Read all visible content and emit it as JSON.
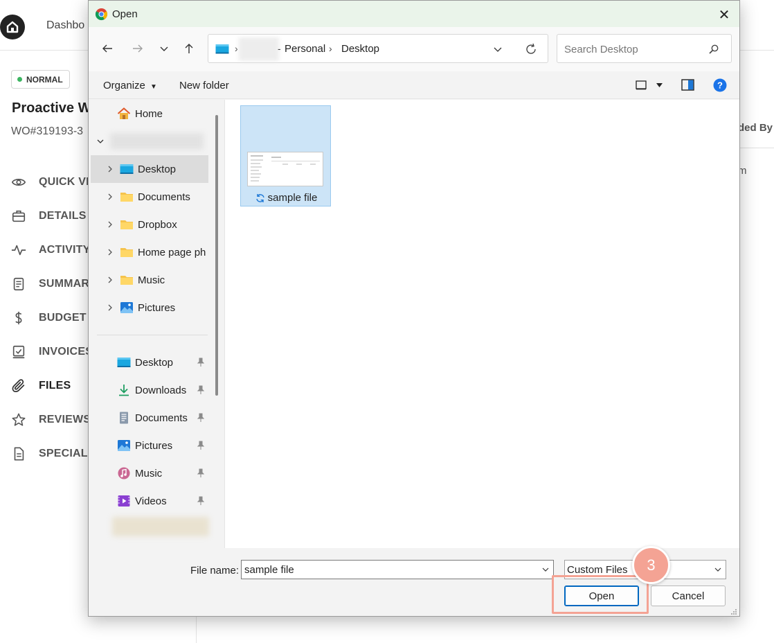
{
  "app": {
    "nav_text": "Dashbo",
    "status_badge": "NORMAL",
    "wo_title": "Proactive W",
    "wo_number": "WO#319193-3",
    "menu": [
      {
        "label": "QUICK VIE",
        "icon": "eye-icon"
      },
      {
        "label": "DETAILS",
        "icon": "briefcase-icon"
      },
      {
        "label": "ACTIVITY",
        "icon": "activity-icon"
      },
      {
        "label": "SUMMAR",
        "icon": "document-icon"
      },
      {
        "label": "BUDGET",
        "icon": "dollar-icon"
      },
      {
        "label": "INVOICES",
        "icon": "invoice-icon"
      },
      {
        "label": "FILES",
        "icon": "paperclip-icon"
      },
      {
        "label": "REVIEWS",
        "icon": "star-icon"
      },
      {
        "label": "SPECIAL N",
        "icon": "note-icon"
      }
    ],
    "right_header": "ded By",
    "right_value": "m"
  },
  "dialog": {
    "title": "Open",
    "close_glyph": "✕",
    "address": {
      "crumbs": [
        "Personal",
        "Desktop"
      ]
    },
    "search_placeholder": "Search Desktop",
    "toolbar": {
      "organize": "Organize",
      "new_folder": "New folder"
    },
    "nav_tree": [
      {
        "label": "Home",
        "icon": "home-icon",
        "expandable": false
      },
      {
        "label": "Desktop",
        "icon": "desktop-folder-icon",
        "expandable": true,
        "selected": true
      },
      {
        "label": "Documents",
        "icon": "folder-icon",
        "expandable": true
      },
      {
        "label": "Dropbox",
        "icon": "folder-icon",
        "expandable": true
      },
      {
        "label": "Home page ph",
        "icon": "folder-icon",
        "expandable": true
      },
      {
        "label": "Music",
        "icon": "folder-icon",
        "expandable": true
      },
      {
        "label": "Pictures",
        "icon": "pictures-icon",
        "expandable": true
      }
    ],
    "quick_access": [
      {
        "label": "Desktop",
        "icon": "desktop-folder-icon"
      },
      {
        "label": "Downloads",
        "icon": "download-icon"
      },
      {
        "label": "Documents",
        "icon": "documents-icon"
      },
      {
        "label": "Pictures",
        "icon": "pictures-icon"
      },
      {
        "label": "Music",
        "icon": "music-icon"
      },
      {
        "label": "Videos",
        "icon": "videos-icon"
      }
    ],
    "files": [
      {
        "name": "sample file",
        "status_icon": "sync-icon"
      }
    ],
    "file_name_label": "File name:",
    "file_name_value": "sample file",
    "file_type": "Custom Files",
    "open_button": "Open",
    "cancel_button": "Cancel"
  },
  "annotation": {
    "step_number": "3",
    "color": "#f4a394"
  }
}
